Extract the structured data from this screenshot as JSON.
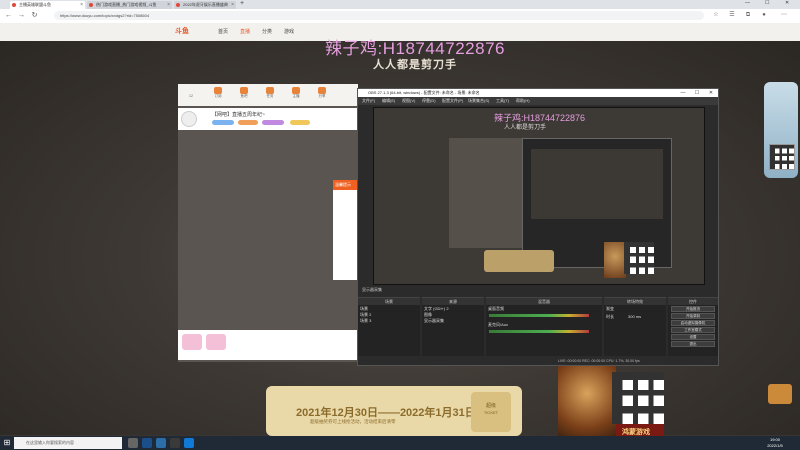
{
  "browser": {
    "tabs": [
      {
        "label": "主播英雄联盟斗鱼"
      },
      {
        "label": "热门游戏直播_热门游戏视频_斗鱼"
      },
      {
        "label": "2022年虎牙娱乐直播盛典"
      }
    ],
    "new_tab": "+",
    "url": "https://www.douyu.com/topic/xxdgs2?rid=7508604",
    "window_controls": {
      "minimize": "—",
      "maximize": "☐",
      "close": "✕"
    }
  },
  "site": {
    "logo": "斗鱼",
    "nav": [
      {
        "label": "首页",
        "active": false
      },
      {
        "label": "直播",
        "active": true
      },
      {
        "label": "分类",
        "active": false
      },
      {
        "label": "游戏",
        "active": false
      }
    ]
  },
  "overlay": {
    "title": "辣子鸡:H18744722876",
    "slogan": "人人都是剪刀手"
  },
  "inner_page": {
    "toolbar_items": [
      {
        "label": "12"
      },
      {
        "label": "订阅"
      },
      {
        "label": "鱼吧"
      },
      {
        "label": "任务"
      },
      {
        "label": "主播"
      },
      {
        "label": "分享"
      }
    ],
    "anchor_title": "【网吧】直播五周年纪~",
    "dialog_head": "温馨提示"
  },
  "obs": {
    "title": "OBS 27.1.3 (64-bit, windows) - 配置文件: 未命名 - 场景: 未命名",
    "menu": [
      "文件(F)",
      "编辑(E)",
      "视图(V)",
      "停靠(D)",
      "配置文件(P)",
      "场景集合(S)",
      "工具(T)",
      "帮助(H)"
    ],
    "preview_source": "显示器采集",
    "docks": {
      "scenes": {
        "header": "场景",
        "items": [
          "场景",
          "场景 2",
          "场景 3"
        ]
      },
      "sources": {
        "header": "来源",
        "items": [
          "文字 (GDI+) 2",
          "图像",
          "显示器采集"
        ]
      },
      "mixer": {
        "header": "混音器",
        "items": [
          "桌面音频",
          "麦克风/Aux"
        ]
      },
      "transitions": {
        "header": "转场特效",
        "items": [
          "渐变",
          "时长"
        ],
        "duration": "300 ms"
      },
      "controls": {
        "header": "控件",
        "buttons": [
          "开始推流",
          "开始录制",
          "启动虚拟摄像机",
          "工作室模式",
          "设置",
          "退出"
        ]
      }
    },
    "status": "LIVE: 00:00:00   REC: 00:00:00   CPU: 1.7%, 30.00 fps"
  },
  "promo": {
    "date": "2021年12月30日——2022年1月31日",
    "sub": "超级抽奖券可上线抢活动，活动结束后清零",
    "ticket_line1": "超级",
    "ticket_line2": "TICKET"
  },
  "brand": {
    "text": "鸿蒙游戏"
  },
  "taskbar": {
    "search_placeholder": "在这里输入你要搜索的内容",
    "clock_time": "19:00",
    "clock_date": "2022/1/5"
  },
  "colors": {
    "accent": "#e65a2c",
    "watermark": "#e59ee0",
    "obs_bg": "#2b2b2b"
  }
}
